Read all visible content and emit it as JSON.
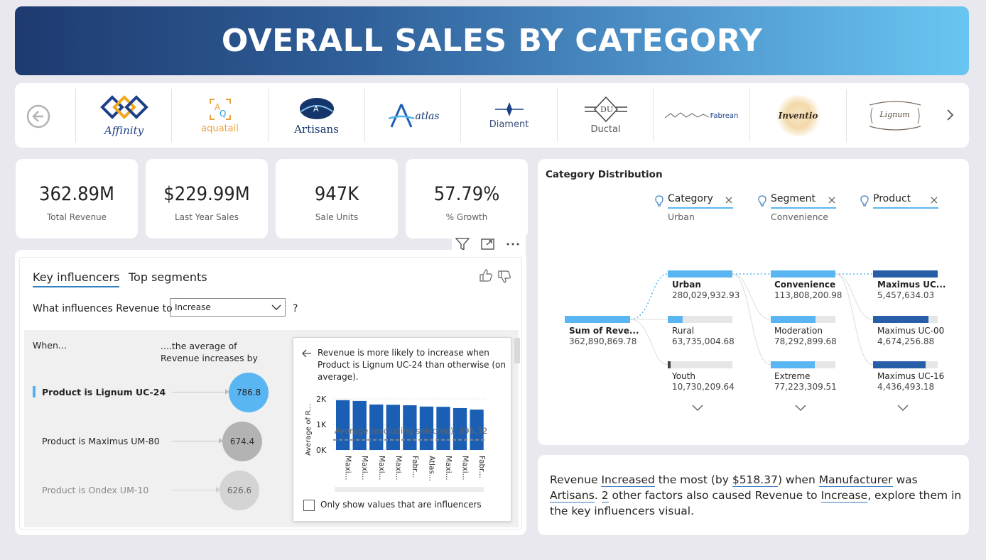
{
  "header": {
    "title": "OVERALL SALES BY CATEGORY"
  },
  "logos": [
    {
      "icon": "affinity-logo",
      "name": "Affinity"
    },
    {
      "icon": "aquatail-logo",
      "name": "aquatail"
    },
    {
      "icon": "artisans-logo",
      "name": "Artisans"
    },
    {
      "icon": "atlas-logo",
      "name": "atlas"
    },
    {
      "icon": "diament-logo",
      "name": "Diament"
    },
    {
      "icon": "ductal-logo",
      "name": "Ductal"
    },
    {
      "icon": "fabrean-logo",
      "name": "Fabrean"
    },
    {
      "icon": "inventio-logo",
      "name": "Inventio"
    },
    {
      "icon": "lignum-logo",
      "name": "Lignum"
    }
  ],
  "kpis": [
    {
      "value": "362.89M",
      "label": "Total Revenue"
    },
    {
      "value": "$229.99M",
      "label": "Last Year Sales"
    },
    {
      "value": "947K",
      "label": "Sale Units"
    },
    {
      "value": "57.79%",
      "label": "% Growth"
    }
  ],
  "key_influencers": {
    "tabs": [
      "Key influencers",
      "Top segments"
    ],
    "question": "What influences Revenue to",
    "dropdown_value": "Increase",
    "question_mark": "?",
    "col_when": "When...",
    "col_avg": "....the average of Revenue increases by",
    "rows": [
      {
        "label": "Product is Lignum UC-24",
        "value": "786.8"
      },
      {
        "label": "Product is Maximus UM-80",
        "value": "674.4"
      },
      {
        "label": "Product is Ondex UM-10",
        "value": "626.6"
      }
    ],
    "popup": {
      "text": "Revenue is more likely to increase when Product is Lignum UC-24 than otherwise (on average).",
      "y_axis_label": "Average of R...",
      "y_ticks": [
        "2K",
        "1K",
        "0K"
      ],
      "avg_label": "Average (excluding selected): 396.32",
      "checkbox_label": "Only show values that are influencers"
    }
  },
  "chart_data": {
    "type": "bar",
    "categories": [
      "Maxi...",
      "Maxi...",
      "Maxi...",
      "Maxi...",
      "Fabr...",
      "Atlas...",
      "Maxi...",
      "Maxi...",
      "Fabr..."
    ],
    "values": [
      1950,
      1920,
      1780,
      1770,
      1750,
      1700,
      1690,
      1640,
      1580
    ],
    "ylabel": "Average of R...",
    "ylim": [
      0,
      2000
    ],
    "reference_line": 396.32,
    "color": "#1a5fb4"
  },
  "tree": {
    "title": "Category Distribution",
    "columns": [
      {
        "name": "Category",
        "selected": "Urban"
      },
      {
        "name": "Segment",
        "selected": "Convenience"
      },
      {
        "name": "Product",
        "selected": ""
      }
    ],
    "root": {
      "name": "Sum of Reve...",
      "value": "362,890,869.78"
    },
    "category_nodes": [
      {
        "name": "Urban",
        "value": "280,029,932.93",
        "fraction": 1.0
      },
      {
        "name": "Rural",
        "value": "63,735,004.68",
        "fraction": 0.23
      },
      {
        "name": "Youth",
        "value": "10,730,209.64",
        "fraction": 0.04
      }
    ],
    "segment_nodes": [
      {
        "name": "Convenience",
        "value": "113,808,200.98",
        "fraction": 1.0
      },
      {
        "name": "Moderation",
        "value": "78,292,899.68",
        "fraction": 0.69
      },
      {
        "name": "Extreme",
        "value": "77,223,309.51",
        "fraction": 0.68
      }
    ],
    "product_nodes": [
      {
        "name": "Maximus UC...",
        "value": "5,457,634.03",
        "fraction": 1.0
      },
      {
        "name": "Maximus UC-00",
        "value": "4,674,256.88",
        "fraction": 0.86
      },
      {
        "name": "Maximus UC-16",
        "value": "4,436,493.18",
        "fraction": 0.81
      }
    ]
  },
  "narrative": {
    "p1": "Revenue ",
    "increased": "Increased",
    "p2": " the most (by ",
    "amount": "$518.37",
    "p3": ") when ",
    "manufacturer": "Manufacturer",
    "p4": " was ",
    "artisans": "Artisans",
    "p5": ". ",
    "two": "2",
    "p6": " other factors also caused Revenue to ",
    "increase": "Increase",
    "p7": ", explore them in the key influencers visual."
  },
  "colors": {
    "accent_light": "#5ab6f2",
    "accent_dark": "#265ea8",
    "header_start": "#1e3a70",
    "header_end": "#69c6f1"
  }
}
